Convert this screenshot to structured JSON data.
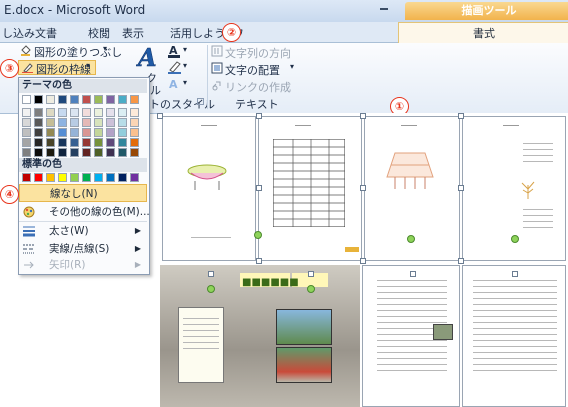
{
  "window": {
    "title": "E.docx - Microsoft Word",
    "contextual_tab_group": "描画ツール",
    "contextual_tab": "書式",
    "caption_buttons": [
      "minimize",
      "maximize"
    ]
  },
  "tabs": [
    "し込み文書",
    "校閲",
    "表示",
    "活用しよう! ワ"
  ],
  "ribbon": {
    "shape_fill": "図形の塗りつぶし",
    "shape_outline": "図形の枠線",
    "wordart_partial": "ク",
    "text_direction": "文字列の方向",
    "text_align": "文字の配置",
    "create_link": "リンクの作成",
    "wordart_styles_group": "トのスタイル",
    "text_group": "テキスト",
    "small_label": "ル"
  },
  "annotations": {
    "callout_1": "①",
    "callout_2": "②",
    "callout_3": "③",
    "callout_4": "④"
  },
  "menu": {
    "theme_colors_header": "テーマの色",
    "standard_colors_header": "標準の色",
    "no_outline": "線なし(N)",
    "more_colors": "その他の線の色(M)...",
    "weight": "太さ(W)",
    "dashes": "実線/点線(S)",
    "arrows": "矢印(R)",
    "theme_top": [
      "#ffffff",
      "#000000",
      "#eeece1",
      "#1f497d",
      "#4f81bd",
      "#c0504d",
      "#9bbb59",
      "#8064a2",
      "#4bacc6",
      "#f79646"
    ],
    "theme_tints": [
      [
        "#f2f2f2",
        "#7f7f7f",
        "#ddd9c3",
        "#c6d9f0",
        "#dbe5f1",
        "#f2dcdb",
        "#ebf1dd",
        "#e5e0ec",
        "#dbeef3",
        "#fdeada"
      ],
      [
        "#d8d8d8",
        "#595959",
        "#c4bd97",
        "#8db3e2",
        "#b8cce4",
        "#e5b9b7",
        "#d7e3bc",
        "#ccc1d9",
        "#b7dde8",
        "#fbd5b5"
      ],
      [
        "#bfbfbf",
        "#3f3f3f",
        "#938953",
        "#548dd4",
        "#95b3d7",
        "#d99694",
        "#c3d69b",
        "#b2a2c7",
        "#92cddc",
        "#fac08f"
      ],
      [
        "#a5a5a5",
        "#262626",
        "#494429",
        "#17365d",
        "#366092",
        "#953734",
        "#76923c",
        "#5f497a",
        "#31859b",
        "#e36c09"
      ],
      [
        "#7f7f7f",
        "#0c0c0c",
        "#1d1b10",
        "#0f243e",
        "#244061",
        "#632423",
        "#4f6128",
        "#3f3151",
        "#205867",
        "#974806"
      ]
    ],
    "standard": [
      "#c00000",
      "#ff0000",
      "#ffc000",
      "#ffff00",
      "#92d050",
      "#00b050",
      "#00b0f0",
      "#0070c0",
      "#002060",
      "#7030a0"
    ]
  },
  "accent": {
    "callout": "#e8341c",
    "highlight": "#fbe3a0",
    "green_handle": "#8ed35a"
  }
}
